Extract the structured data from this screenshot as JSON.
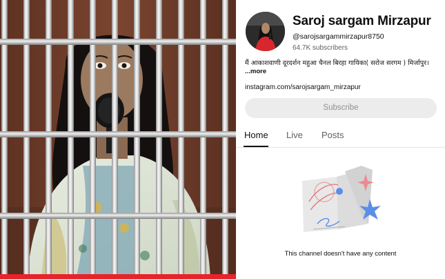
{
  "thumbnail": {
    "stripe_color": "#e8232a"
  },
  "channel": {
    "name": "Saroj sargam Mirzapur",
    "handle": "@sarojsargammirzapur8750",
    "subscribers": "64.7K subscribers",
    "description": "मैं आकाशवाणी दूरदर्शन महुआ चैनल बिरहा गायिका( सरोज सरगम ) मिर्जापुर। ",
    "more_label": "...more",
    "link": "instagram.com/sarojsargam_mirzapur"
  },
  "subscribe_label": "Subscribe",
  "tabs": [
    {
      "label": "Home",
      "active": true
    },
    {
      "label": "Live",
      "active": false
    },
    {
      "label": "Posts",
      "active": false
    }
  ],
  "empty_state": {
    "text": "This channel doesn't have any content",
    "icon": "empty-channel-illustration"
  },
  "colors": {
    "subscribe_bg": "#ececec",
    "subscribe_text": "#909090",
    "muted_text": "#606060",
    "avatar_dress": "#d8262e"
  }
}
